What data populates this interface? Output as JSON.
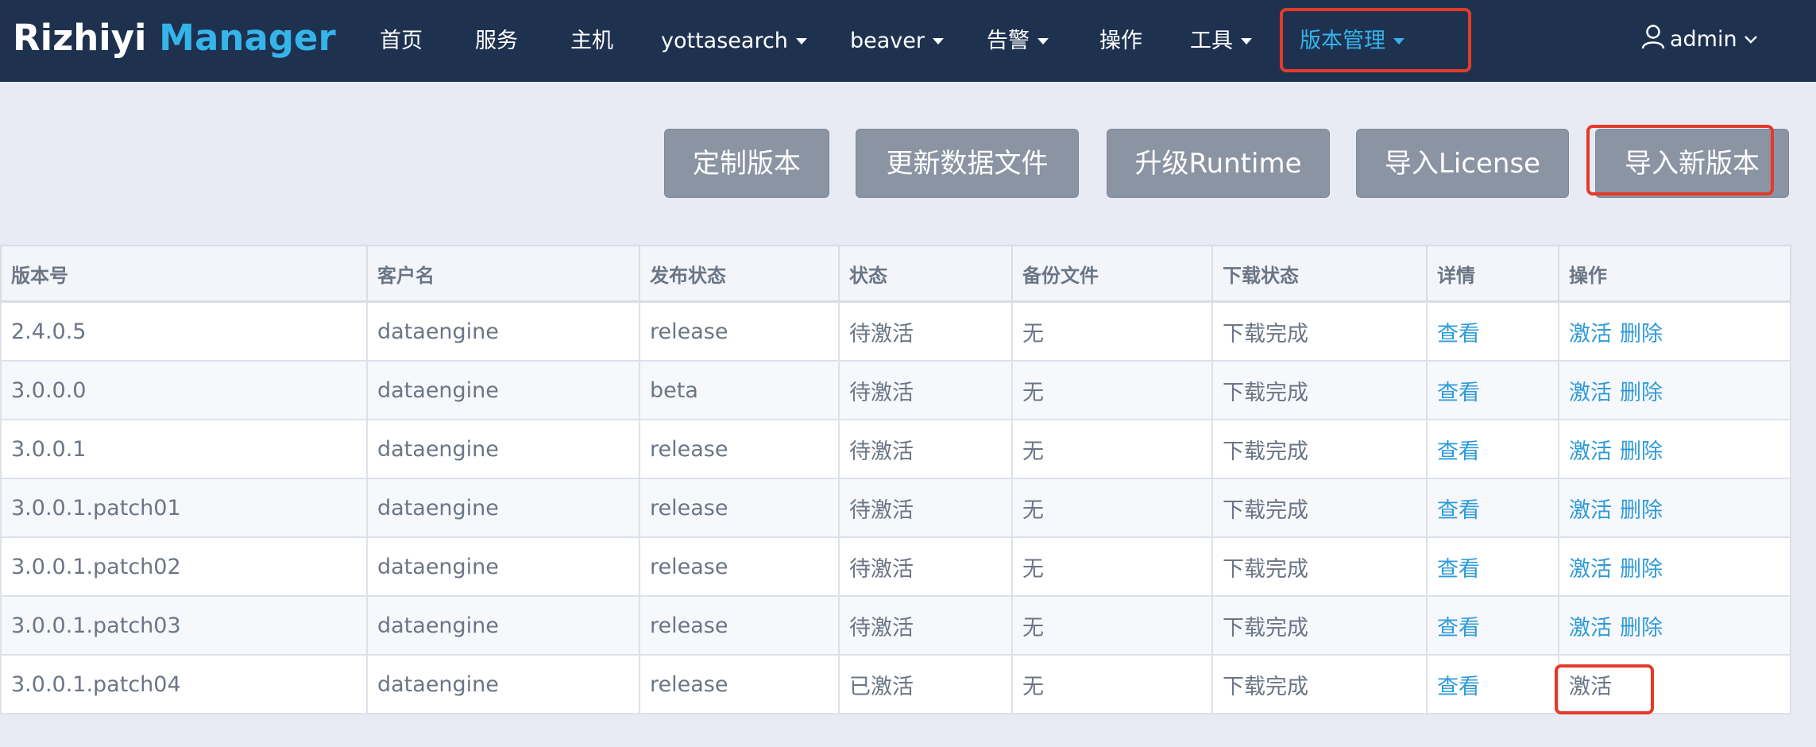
{
  "brand": {
    "part1": "Rizhiyi",
    "part2": "Manager"
  },
  "nav": {
    "items": [
      {
        "label": "首页"
      },
      {
        "label": "服务"
      },
      {
        "label": "主机"
      },
      {
        "label": "yottasearch"
      },
      {
        "label": "beaver"
      },
      {
        "label": "告警"
      },
      {
        "label": "操作"
      },
      {
        "label": "工具"
      },
      {
        "label": "版本管理"
      }
    ],
    "user": "admin"
  },
  "actions": {
    "custom_version": "定制版本",
    "update_data_file": "更新数据文件",
    "upgrade_runtime": "升级Runtime",
    "import_license": "导入License",
    "import_new_version": "导入新版本"
  },
  "table": {
    "headers": [
      "版本号",
      "客户名",
      "发布状态",
      "状态",
      "备份文件",
      "下载状态",
      "详情",
      "操作"
    ],
    "rows": [
      {
        "version": "2.4.0.5",
        "customer": "dataengine",
        "release": "release",
        "status": "待激活",
        "backup": "无",
        "download": "下载完成",
        "detail": "查看",
        "op_activate": "激活",
        "op_delete": "删除"
      },
      {
        "version": "3.0.0.0",
        "customer": "dataengine",
        "release": "beta",
        "status": "待激活",
        "backup": "无",
        "download": "下载完成",
        "detail": "查看",
        "op_activate": "激活",
        "op_delete": "删除"
      },
      {
        "version": "3.0.0.1",
        "customer": "dataengine",
        "release": "release",
        "status": "待激活",
        "backup": "无",
        "download": "下载完成",
        "detail": "查看",
        "op_activate": "激活",
        "op_delete": "删除"
      },
      {
        "version": "3.0.0.1.patch01",
        "customer": "dataengine",
        "release": "release",
        "status": "待激活",
        "backup": "无",
        "download": "下载完成",
        "detail": "查看",
        "op_activate": "激活",
        "op_delete": "删除"
      },
      {
        "version": "3.0.0.1.patch02",
        "customer": "dataengine",
        "release": "release",
        "status": "待激活",
        "backup": "无",
        "download": "下载完成",
        "detail": "查看",
        "op_activate": "激活",
        "op_delete": "删除"
      },
      {
        "version": "3.0.0.1.patch03",
        "customer": "dataengine",
        "release": "release",
        "status": "待激活",
        "backup": "无",
        "download": "下载完成",
        "detail": "查看",
        "op_activate": "激活",
        "op_delete": "删除"
      },
      {
        "version": "3.0.0.1.patch04",
        "customer": "dataengine",
        "release": "release",
        "status": "已激活",
        "backup": "无",
        "download": "下载完成",
        "detail": "查看",
        "op_activate": "激活"
      }
    ]
  },
  "colors": {
    "navbar_bg": "#1e3250",
    "accent": "#35b4ea",
    "link": "#2f9bd8",
    "button_bg": "#8b94a3",
    "highlight": "#e43a2a",
    "page_bg": "#e8ebf3"
  },
  "icons": {
    "user": "user-icon",
    "caret": "caret-down-icon",
    "chevron": "chevron-down-icon"
  }
}
